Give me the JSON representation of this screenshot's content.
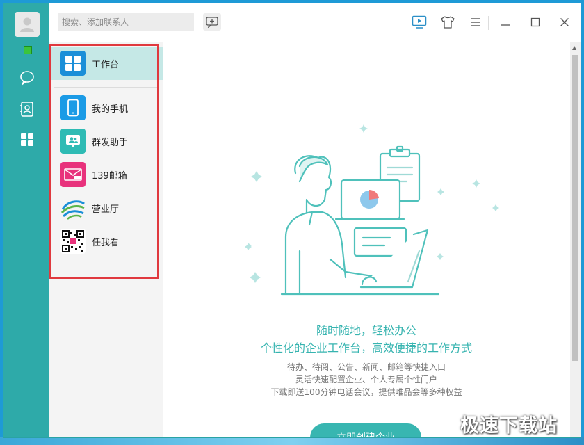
{
  "search": {
    "placeholder": "搜索、添加联系人"
  },
  "sidebar": {
    "items": [
      {
        "label": "工作台"
      },
      {
        "label": "我的手机"
      },
      {
        "label": "群发助手"
      },
      {
        "label": "139邮箱"
      },
      {
        "label": "营业厅"
      },
      {
        "label": "任我看"
      }
    ]
  },
  "main": {
    "headline": "随时随地，轻松办公",
    "subheadline": "个性化的企业工作台，高效便捷的工作方式",
    "lines": [
      "待办、待阅、公告、新闻、邮箱等快捷入口",
      "灵活快速配置企业、个人专属个性门户",
      "下载即送100分钟电话会议，提供唯品会等多种权益"
    ],
    "button": "立即创建企业"
  },
  "watermark": "极速下载站",
  "colors": {
    "accent": "#2eaaa9",
    "highlight": "#e0393e",
    "mail_icon": "#e8327c",
    "phone_icon": "#1b9be6"
  }
}
